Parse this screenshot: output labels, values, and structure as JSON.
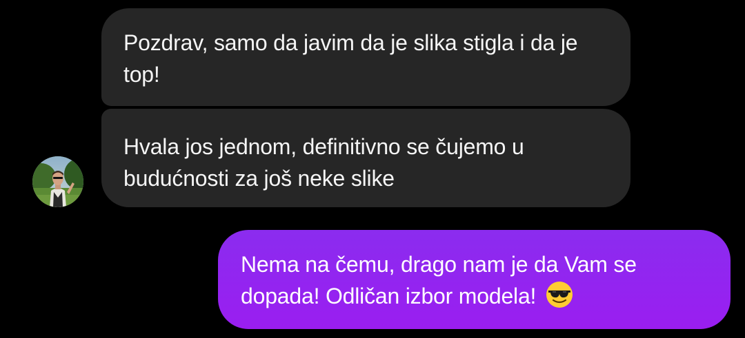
{
  "conversation": {
    "incoming": [
      {
        "text": "Pozdrav, samo da javim da je slika stigla i da je top!"
      },
      {
        "text": "Hvala jos jednom, definitivno se čujemo u budućnosti za još neke slike"
      }
    ],
    "outgoing": [
      {
        "text": "Nema na čemu, drago nam je da Vam se dopada! Odličan izbor modela! 😎",
        "emoji": "smiling-face-with-sunglasses-icon"
      }
    ]
  },
  "colors": {
    "background": "#000000",
    "incoming_bubble": "#262626",
    "outgoing_bubble": "#8b2cef",
    "text": "#ffffff"
  }
}
